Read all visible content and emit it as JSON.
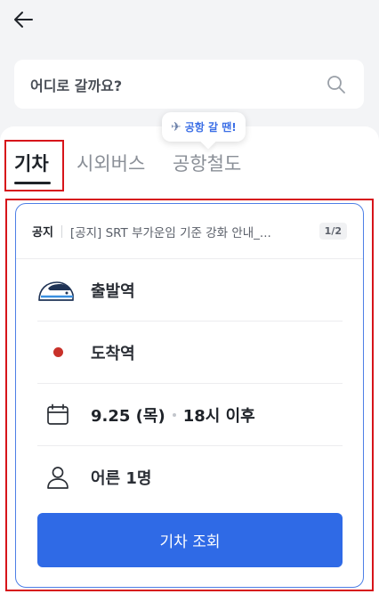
{
  "search": {
    "placeholder": "어디로 갈까요?"
  },
  "tabs": [
    {
      "label": "기차",
      "active": true
    },
    {
      "label": "시외버스",
      "active": false
    },
    {
      "label": "공항철도",
      "active": false
    }
  ],
  "tooltip": {
    "text": "공항 갈 땐!"
  },
  "notice": {
    "tag": "공지",
    "text": "[공지] SRT 부가운임 기준 강화 안내_...",
    "page": "1/2"
  },
  "departure": {
    "label": "출발역"
  },
  "arrival": {
    "label": "도착역"
  },
  "date": {
    "day": "9.25 (목)",
    "time": "18시 이후"
  },
  "passengers": {
    "label": "어른 1명"
  },
  "search_button": {
    "label": "기차 조회"
  },
  "icons": {
    "back": "arrow-left-icon",
    "search": "search-icon",
    "plane": "airplane-icon",
    "train": "train-icon",
    "calendar": "calendar-icon",
    "person": "person-icon"
  },
  "colors": {
    "accent": "#2f6ae6",
    "highlight": "#d7141a",
    "arrival_dot": "#c8312a",
    "card_border": "#4d7fe6"
  }
}
